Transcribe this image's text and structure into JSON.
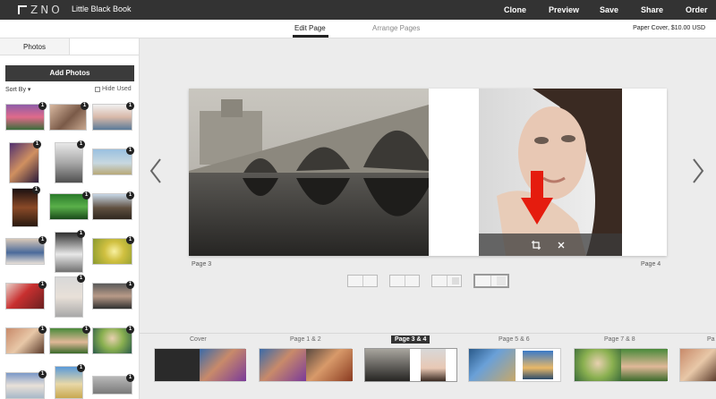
{
  "topbar": {
    "logo_text": "ZNO",
    "book_title": "Little Black Book",
    "actions": [
      "Clone",
      "Preview",
      "Save",
      "Share",
      "Order"
    ]
  },
  "subbar": {
    "tabs": [
      "Edit Page",
      "Arrange Pages"
    ],
    "cover_info": "Paper Cover, $10.00 USD"
  },
  "leftpanel": {
    "tab_photos": "Photos",
    "add_photos": "Add Photos",
    "sort_by": "Sort By ▾",
    "hide_used": "Hide Used",
    "badge": "1"
  },
  "spread": {
    "left_page_label": "Page 3",
    "right_page_label": "Page 4"
  },
  "filmstrip": {
    "labels": [
      "Cover",
      "Page 1 & 2",
      "Page 3 & 4",
      "Page 5 & 6",
      "Page 7 & 8",
      "Pa"
    ]
  }
}
